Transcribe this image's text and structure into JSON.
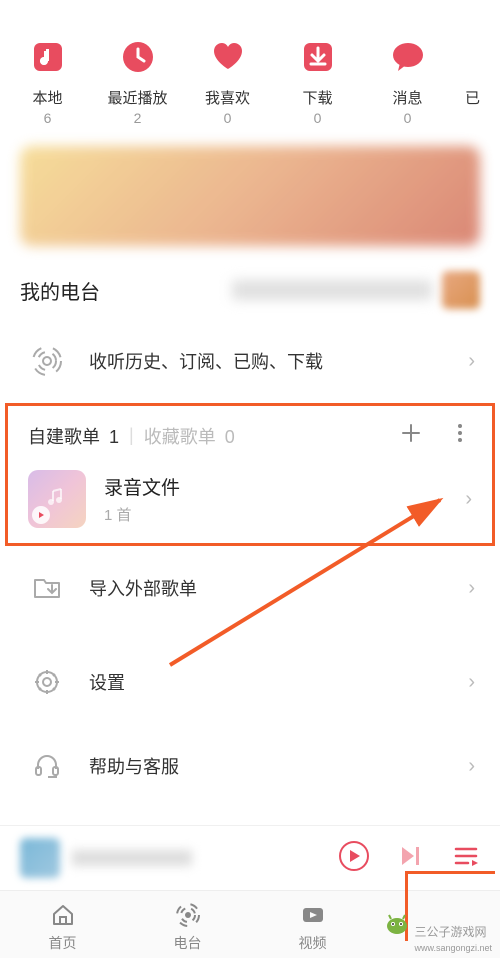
{
  "quick_menu": [
    {
      "label": "本地",
      "count": "6",
      "icon": "music-note"
    },
    {
      "label": "最近播放",
      "count": "2",
      "icon": "clock"
    },
    {
      "label": "我喜欢",
      "count": "0",
      "icon": "heart"
    },
    {
      "label": "下载",
      "count": "0",
      "icon": "download"
    },
    {
      "label": "消息",
      "count": "0",
      "icon": "message"
    },
    {
      "label": "已",
      "count": "",
      "icon": "none"
    }
  ],
  "my_radio_title": "我的电台",
  "history_row": "收听历史、订阅、已购、下载",
  "playlist_tabs": {
    "own_label": "自建歌单",
    "own_count": "1",
    "fav_label": "收藏歌单",
    "fav_count": "0"
  },
  "playlist": {
    "name": "录音文件",
    "count": "1 首"
  },
  "import_label": "导入外部歌单",
  "settings_label": "设置",
  "help_label": "帮助与客服",
  "nav": [
    {
      "label": "首页",
      "icon": "home"
    },
    {
      "label": "电台",
      "icon": "radio"
    },
    {
      "label": "视频",
      "icon": "video"
    },
    {
      "label": "",
      "icon": "hidden"
    }
  ],
  "watermark": "三公子游戏网",
  "watermark_url": "www.sangongzi.net",
  "accent": "#e84c5f",
  "highlight": "#f25c28"
}
